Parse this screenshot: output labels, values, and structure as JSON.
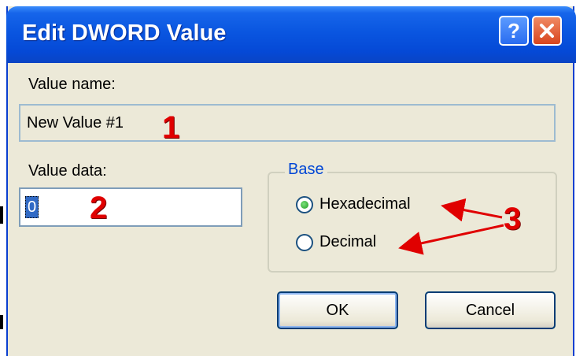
{
  "window": {
    "title": "Edit DWORD Value",
    "help_symbol": "?",
    "close_icon": "close-icon"
  },
  "value_name": {
    "label": "Value name:",
    "value": "New Value #1"
  },
  "value_data": {
    "label": "Value data:",
    "value": "0"
  },
  "base": {
    "legend": "Base",
    "options": [
      {
        "label": "Hexadecimal",
        "selected": true
      },
      {
        "label": "Decimal",
        "selected": false
      }
    ]
  },
  "buttons": {
    "ok": "OK",
    "cancel": "Cancel"
  },
  "annotations": {
    "one": "1",
    "two": "2",
    "three": "3",
    "color": "#e00000"
  },
  "colors": {
    "titlebar": "#0a56e0",
    "dialog_bg": "#ece9d8",
    "legend_text": "#0046d5"
  }
}
